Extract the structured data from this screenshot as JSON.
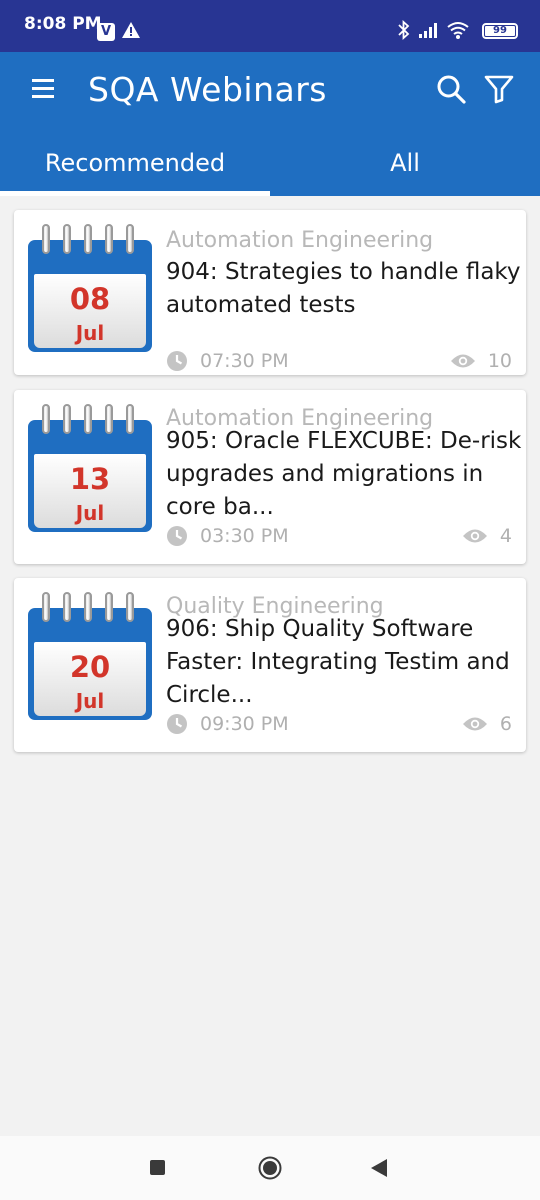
{
  "status_bar": {
    "time": "8:08 PM",
    "app_badge": "V",
    "battery": "99",
    "icons": [
      "v-app-icon",
      "alert-icon",
      "bluetooth-icon",
      "signal-icon",
      "wifi-icon",
      "battery-icon"
    ]
  },
  "app_bar": {
    "title": "SQA Webinars",
    "icons": [
      "menu-icon",
      "search-icon",
      "filter-icon"
    ],
    "color": "#1f6ec1"
  },
  "tabs": [
    {
      "label": "Recommended",
      "selected": true
    },
    {
      "label": "All",
      "selected": false
    }
  ],
  "webinars": [
    {
      "day": "08",
      "month": "Jul",
      "category": "Automation Engineering",
      "title": "904: Strategies to handle flaky automated tests",
      "time": "07:30 PM",
      "views": "10"
    },
    {
      "day": "13",
      "month": "Jul",
      "category": "Automation Engineering",
      "title": "905: Oracle FLEXCUBE: De-risk upgrades and migrations in core ba...",
      "time": "03:30 PM",
      "views": "4"
    },
    {
      "day": "20",
      "month": "Jul",
      "category": "Quality Engineering",
      "title": "906: Ship Quality Software Faster: Integrating Testim and Circle...",
      "time": "09:30 PM",
      "views": "6"
    }
  ],
  "nav_bar": {
    "icons": [
      "recent-apps-icon",
      "home-icon",
      "back-icon"
    ]
  },
  "colors": {
    "primary": "#1f6ec1",
    "status_bar": "#283593",
    "date_red": "#d2352a"
  }
}
